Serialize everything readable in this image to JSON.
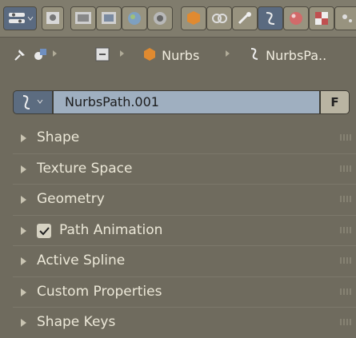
{
  "toolbar": {
    "icons": [
      "render-layers-icon",
      "scene-icon",
      "world-icon",
      "object-icon",
      "constraints-icon",
      "modifiers-icon",
      "data-icon",
      "material-icon",
      "texture-icon",
      "particles-icon",
      "physics-icon"
    ]
  },
  "breadcrumbs": {
    "pin_icon": "pin-icon",
    "scene_icon": "scene-icon",
    "object_label": "Nurbs",
    "data_label": "NurbsPa.."
  },
  "datablock": {
    "name": "NurbsPath.001",
    "fake_user_label": "F"
  },
  "panels": [
    {
      "label": "Shape"
    },
    {
      "label": "Texture Space"
    },
    {
      "label": "Geometry"
    },
    {
      "label": "Path Animation",
      "checkbox": true
    },
    {
      "label": "Active Spline"
    },
    {
      "label": "Custom Properties"
    },
    {
      "label": "Shape Keys"
    }
  ],
  "colors": {
    "background": "#6f6b5e",
    "name_field": "#9fafc0",
    "active_tab": "#5a6a80"
  }
}
